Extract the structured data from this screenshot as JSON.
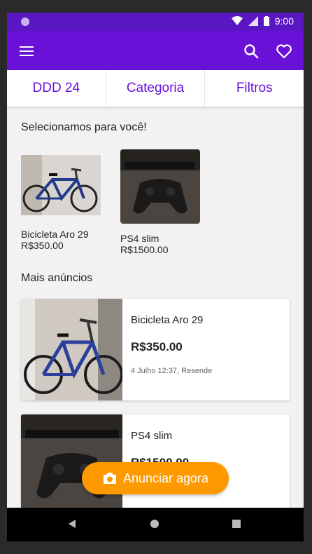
{
  "status": {
    "time": "9:00"
  },
  "filters": [
    "DDD 24",
    "Categoria",
    "Filtros"
  ],
  "selected": {
    "title": "Selecionamos para você!",
    "items": [
      {
        "title": "Bicicleta Aro 29",
        "price": "R$350.00"
      },
      {
        "title": "PS4 slim",
        "price": "R$1500.00"
      }
    ]
  },
  "more": {
    "title": "Mais anúncios",
    "items": [
      {
        "title": "Bicicleta Aro 29",
        "price": "R$350.00",
        "meta": "4 Julho 12:37, Resende"
      },
      {
        "title": "PS4 slim",
        "price": "R$1500.00",
        "meta": ""
      }
    ]
  },
  "fab": {
    "label": "Anunciar agora"
  },
  "colors": {
    "primary": "#6a11d8",
    "statusbar": "#5a16c2",
    "accent": "#ff9900"
  }
}
